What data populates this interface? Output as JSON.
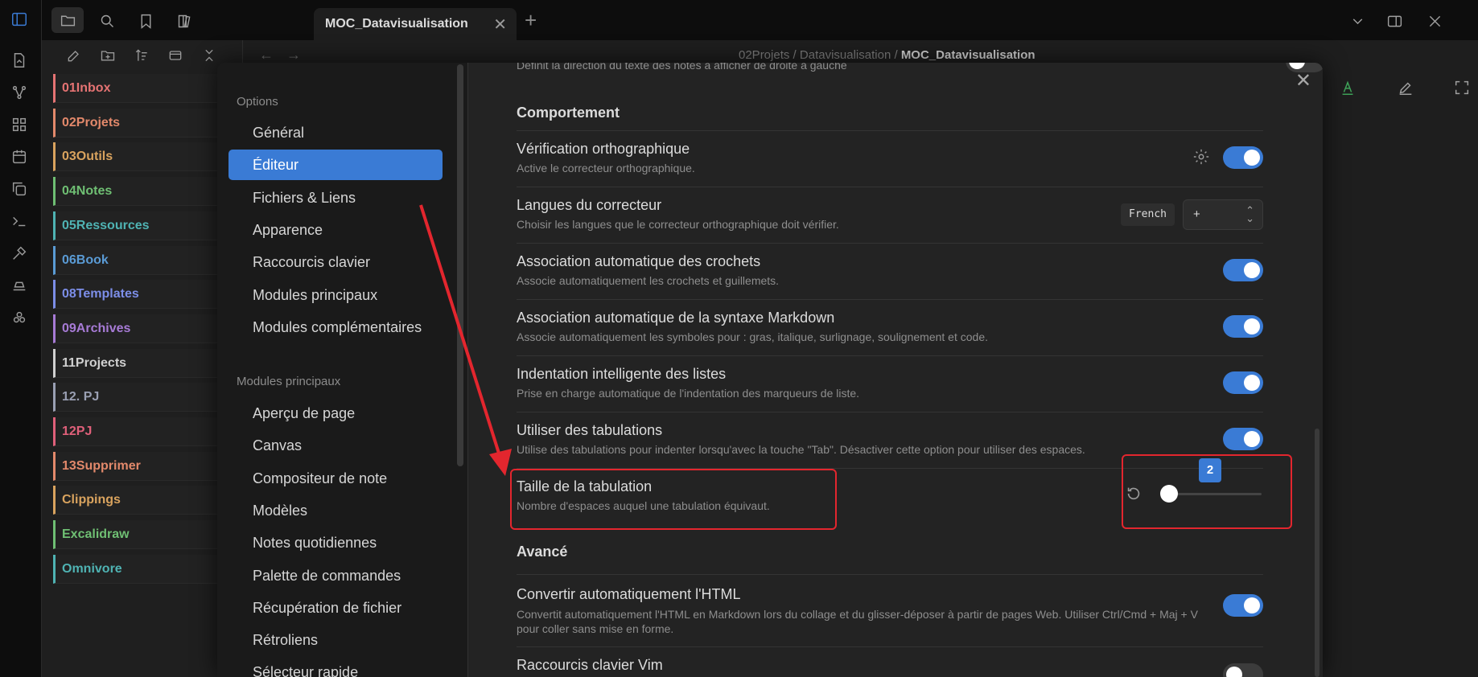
{
  "app": {
    "tab_title": "MOC_Datavisualisation",
    "breadcrumb": {
      "part1": "02Projets",
      "sep1": "/",
      "part2": "Datavisualisation",
      "sep2": "/",
      "current": "MOC_Datavisualisation"
    }
  },
  "explorer": {
    "folders": [
      {
        "label": "01Inbox",
        "color": "#e57373"
      },
      {
        "label": "02Projets",
        "color": "#e3896b"
      },
      {
        "label": "03Outils",
        "color": "#d9a35e"
      },
      {
        "label": "04Notes",
        "color": "#6fbf73"
      },
      {
        "label": "05Ressources",
        "color": "#4fb3b3"
      },
      {
        "label": "06Book",
        "color": "#5a9bd5"
      },
      {
        "label": "08Templates",
        "color": "#7c8ee8"
      },
      {
        "label": "09Archives",
        "color": "#a77bd6"
      },
      {
        "label": "11Projects",
        "color": "#d0d0d0"
      },
      {
        "label": "12. PJ",
        "color": "#9aa0b3"
      },
      {
        "label": "12PJ",
        "color": "#e0607a"
      },
      {
        "label": "13Supprimer",
        "color": "#e3896b"
      },
      {
        "label": "Clippings",
        "color": "#d9a35e"
      },
      {
        "label": "Excalidraw",
        "color": "#6fbf73"
      },
      {
        "label": "Omnivore",
        "color": "#4fb3b3"
      }
    ]
  },
  "settings_nav": {
    "options_header": "Options",
    "options": [
      "Général",
      "Éditeur",
      "Fichiers & Liens",
      "Apparence",
      "Raccourcis clavier",
      "Modules principaux",
      "Modules complémentaires"
    ],
    "selected": "Éditeur",
    "core_header": "Modules principaux",
    "core": [
      "Aperçu de page",
      "Canvas",
      "Compositeur de note",
      "Modèles",
      "Notes quotidiennes",
      "Palette de commandes",
      "Récupération de fichier",
      "Rétroliens",
      "Sélecteur rapide"
    ]
  },
  "settings": {
    "top_partial_desc": "Définit la direction du texte des notes à afficher de droite à gauche",
    "section_behavior": "Comportement",
    "spellcheck": {
      "title": "Vérification orthographique",
      "desc": "Active le correcteur orthographique.",
      "on": true
    },
    "spell_langs": {
      "title": "Langues du correcteur",
      "desc": "Choisir les langues que le correcteur orthographique doit vérifier.",
      "lang_tag": "French",
      "select_value": "+"
    },
    "auto_brackets": {
      "title": "Association automatique des crochets",
      "desc": "Associe automatiquement les crochets et guillemets.",
      "on": true
    },
    "auto_markdown": {
      "title": "Association automatique de la syntaxe Markdown",
      "desc": "Associe automatiquement les symboles pour : gras, italique, surlignage, soulignement et code.",
      "on": true
    },
    "smart_indent": {
      "title": "Indentation intelligente des listes",
      "desc": "Prise en charge automatique de l'indentation des marqueurs de liste.",
      "on": true
    },
    "use_tabs": {
      "title": "Utiliser des tabulations",
      "desc": "Utilise des tabulations pour indenter lorsqu'avec la touche \"Tab\". Désactiver cette option pour utiliser des espaces.",
      "on": true
    },
    "tab_size": {
      "title": "Taille de la tabulation",
      "desc": "Nombre d'espaces auquel une tabulation équivaut.",
      "value": "2"
    },
    "section_advanced": "Avancé",
    "auto_html": {
      "title": "Convertir automatiquement l'HTML",
      "desc": "Convertit automatiquement l'HTML en Markdown lors du collage et du glisser-déposer à partir de pages Web. Utiliser Ctrl/Cmd + Maj + V pour coller sans mise en forme.",
      "on": true
    },
    "vim": {
      "title": "Raccourcis clavier Vim",
      "on": false
    }
  },
  "colors": {
    "accent": "#3a7bd5",
    "annotation": "#e3262e"
  }
}
